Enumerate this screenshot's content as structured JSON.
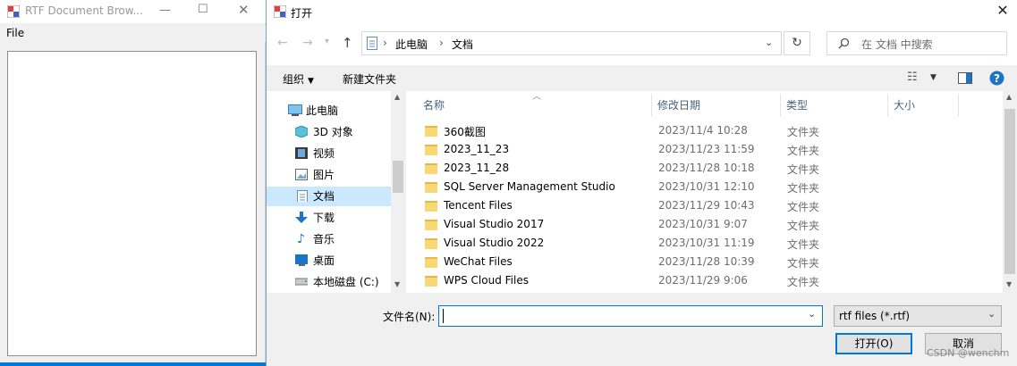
{
  "background_window": {
    "title": "RTF Document Brow...",
    "menu_file": "File"
  },
  "dialog": {
    "title": "打开",
    "breadcrumb": [
      "此电脑",
      "文档"
    ],
    "search_placeholder": "在 文档 中搜索",
    "toolbar": {
      "organize": "组织",
      "new_folder": "新建文件夹"
    },
    "columns": {
      "name": "名称",
      "modified": "修改日期",
      "type": "类型",
      "size": "大小"
    },
    "nav": [
      {
        "label": "此电脑",
        "icon": "computer-icon"
      },
      {
        "label": "3D 对象",
        "icon": "cube-icon"
      },
      {
        "label": "视频",
        "icon": "film-icon"
      },
      {
        "label": "图片",
        "icon": "picture-icon"
      },
      {
        "label": "文档",
        "icon": "document-icon",
        "selected": true
      },
      {
        "label": "下载",
        "icon": "download-arrow-icon"
      },
      {
        "label": "音乐",
        "icon": "music-note-icon"
      },
      {
        "label": "桌面",
        "icon": "desktop-icon"
      },
      {
        "label": "本地磁盘 (C:)",
        "icon": "drive-icon"
      }
    ],
    "files": [
      {
        "name": "360截图",
        "date": "2023/11/4 10:28",
        "type": "文件夹"
      },
      {
        "name": "2023_11_23",
        "date": "2023/11/23 11:59",
        "type": "文件夹"
      },
      {
        "name": "2023_11_28",
        "date": "2023/11/28 10:18",
        "type": "文件夹"
      },
      {
        "name": "SQL Server Management Studio",
        "date": "2023/10/31 12:10",
        "type": "文件夹"
      },
      {
        "name": "Tencent Files",
        "date": "2023/11/29 10:43",
        "type": "文件夹"
      },
      {
        "name": "Visual Studio 2017",
        "date": "2023/10/31 9:07",
        "type": "文件夹"
      },
      {
        "name": "Visual Studio 2022",
        "date": "2023/10/31 11:19",
        "type": "文件夹"
      },
      {
        "name": "WeChat Files",
        "date": "2023/11/28 10:39",
        "type": "文件夹"
      },
      {
        "name": "WPS Cloud Files",
        "date": "2023/11/29 9:06",
        "type": "文件夹"
      }
    ],
    "filename_label": "文件名(N):",
    "filename_value": "",
    "filter": "rtf files (*.rtf)",
    "open_button": "打开(O)",
    "cancel_button": "取消"
  },
  "watermark": "CSDN @wenchm",
  "colors": {
    "accent": "#0078d7",
    "selected_nav": "#cce8ff",
    "folder": "#f8d775"
  }
}
